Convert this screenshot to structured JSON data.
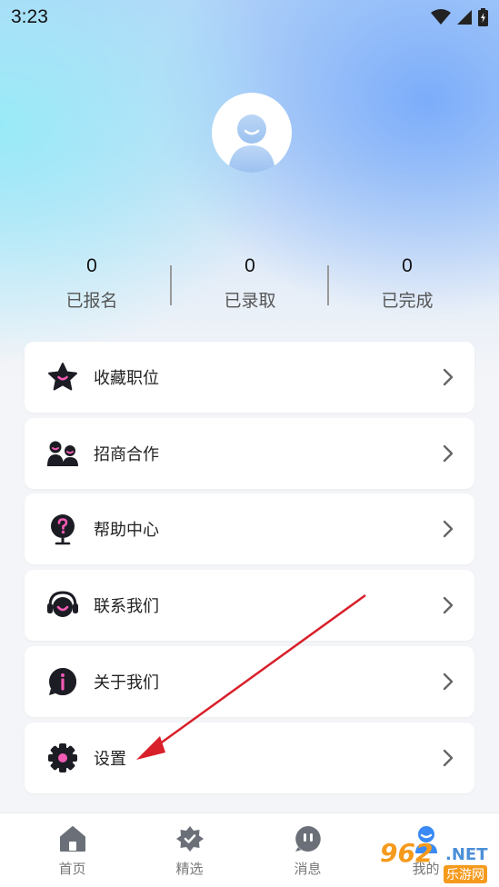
{
  "status_bar": {
    "time": "3:23"
  },
  "profile": {
    "avatar_icon": "user-avatar-icon"
  },
  "stats": [
    {
      "value": "0",
      "label": "已报名"
    },
    {
      "value": "0",
      "label": "已录取"
    },
    {
      "value": "0",
      "label": "已完成"
    }
  ],
  "menu": [
    {
      "label": "收藏职位",
      "icon": "star-icon"
    },
    {
      "label": "招商合作",
      "icon": "partners-icon"
    },
    {
      "label": "帮助中心",
      "icon": "help-icon"
    },
    {
      "label": "联系我们",
      "icon": "headset-icon"
    },
    {
      "label": "关于我们",
      "icon": "info-icon"
    },
    {
      "label": "设置",
      "icon": "gear-icon"
    }
  ],
  "bottom_nav": [
    {
      "label": "首页",
      "icon": "home-icon"
    },
    {
      "label": "精选",
      "icon": "featured-icon"
    },
    {
      "label": "消息",
      "icon": "message-icon"
    },
    {
      "label": "我的",
      "icon": "profile-icon"
    }
  ],
  "watermark": {
    "logo": "962",
    "domain": ".NET",
    "sub": "乐游网"
  },
  "colors": {
    "accent_pink": "#f25bb4",
    "icon_dark": "#1c1c24",
    "active_blue": "#3a8af5",
    "annotation_red": "#d8202a"
  }
}
